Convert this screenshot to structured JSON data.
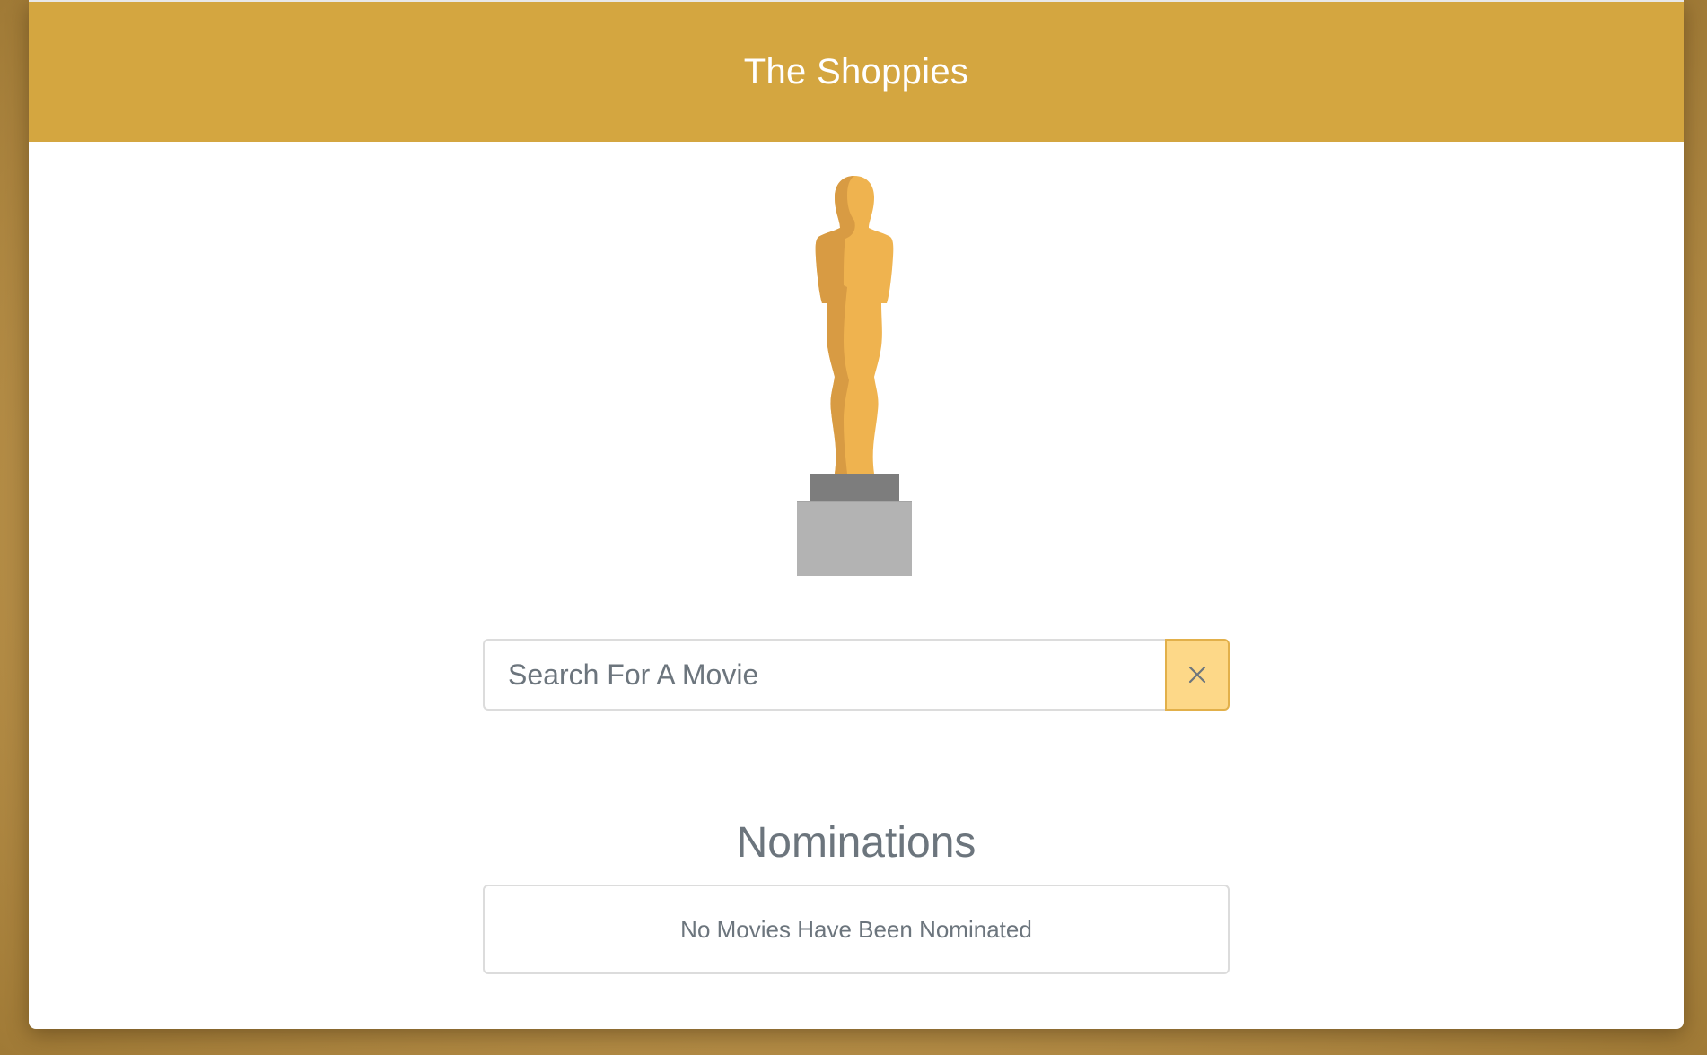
{
  "header": {
    "title": "The Shoppies"
  },
  "logo": {
    "icon": "trophy-statue-icon"
  },
  "search": {
    "placeholder": "Search For A Movie",
    "value": "",
    "clear_icon": "close-icon"
  },
  "nominations": {
    "heading": "Nominations",
    "empty_message": "No Movies Have Been Nominated"
  },
  "colors": {
    "header_bg": "#d4a640",
    "button_bg": "#fdd888",
    "trophy_gold": "#efb34f",
    "trophy_shadow": "#d89b43",
    "pedestal_top": "#7d7d7d",
    "pedestal_base": "#b3b3b3"
  }
}
